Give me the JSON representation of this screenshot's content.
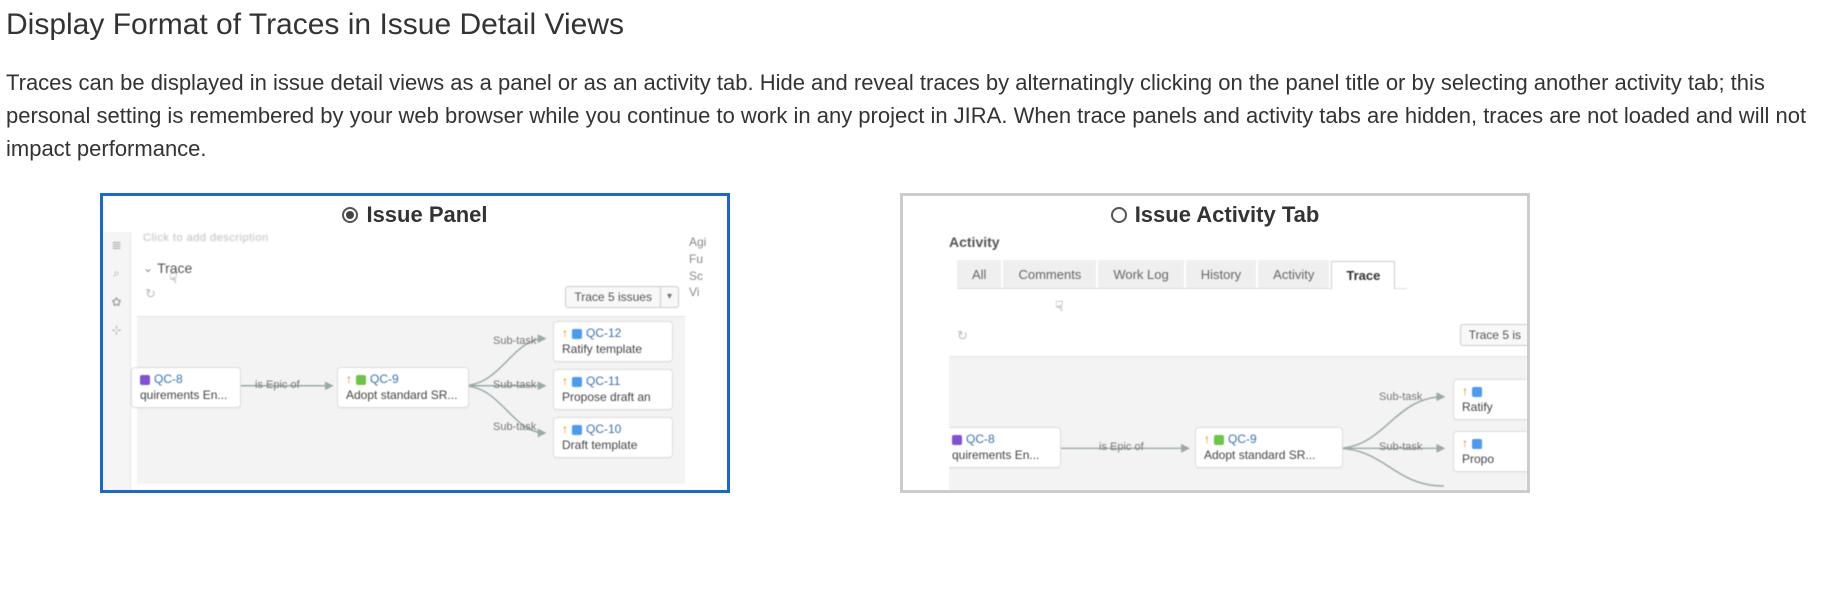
{
  "title": "Display Format of Traces in Issue Detail Views",
  "intro": "Traces can be displayed in issue detail views as a panel or as an activity tab. Hide and reveal traces by alternatingly clicking on the panel title or by selecting another activity tab; this personal setting is remembered by your web browser while you continue to work in any project in JIRA. When trace panels and activity tabs are hidden, traces are not loaded and will not impact performance.",
  "optionA": {
    "label": "Issue Panel",
    "selected": true,
    "descPlaceholder": "Click to add description",
    "traceHeader": "Trace",
    "traceButton": "Trace 5 issues",
    "rightSnip": [
      "Agi",
      "Fu",
      "Sc",
      "Vi"
    ],
    "edge_epic": "is Epic of",
    "edge_sub": "Sub-task",
    "nodes": {
      "qc8": {
        "key": "QC-8",
        "text": "quirements En..."
      },
      "qc9": {
        "key": "QC-9",
        "text": "Adopt standard SR..."
      },
      "qc12": {
        "key": "QC-12",
        "text": "Ratify template"
      },
      "qc11": {
        "key": "QC-11",
        "text": "Propose draft an"
      },
      "qc10": {
        "key": "QC-10",
        "text": "Draft template"
      }
    }
  },
  "optionB": {
    "label": "Issue Activity Tab",
    "selected": false,
    "activityTitle": "Activity",
    "tabs": [
      "All",
      "Comments",
      "Work Log",
      "History",
      "Activity",
      "Trace"
    ],
    "activeTab": "Trace",
    "traceButton": "Trace 5 is",
    "edge_epic": "is Epic of",
    "edge_sub": "Sub-task",
    "nodes": {
      "qc8": {
        "key": "QC-8",
        "text": "quirements En..."
      },
      "qc9": {
        "key": "QC-9",
        "text": "Adopt standard SR..."
      },
      "r1": {
        "text": "Ratify"
      },
      "r2": {
        "text": "Propo"
      }
    }
  }
}
